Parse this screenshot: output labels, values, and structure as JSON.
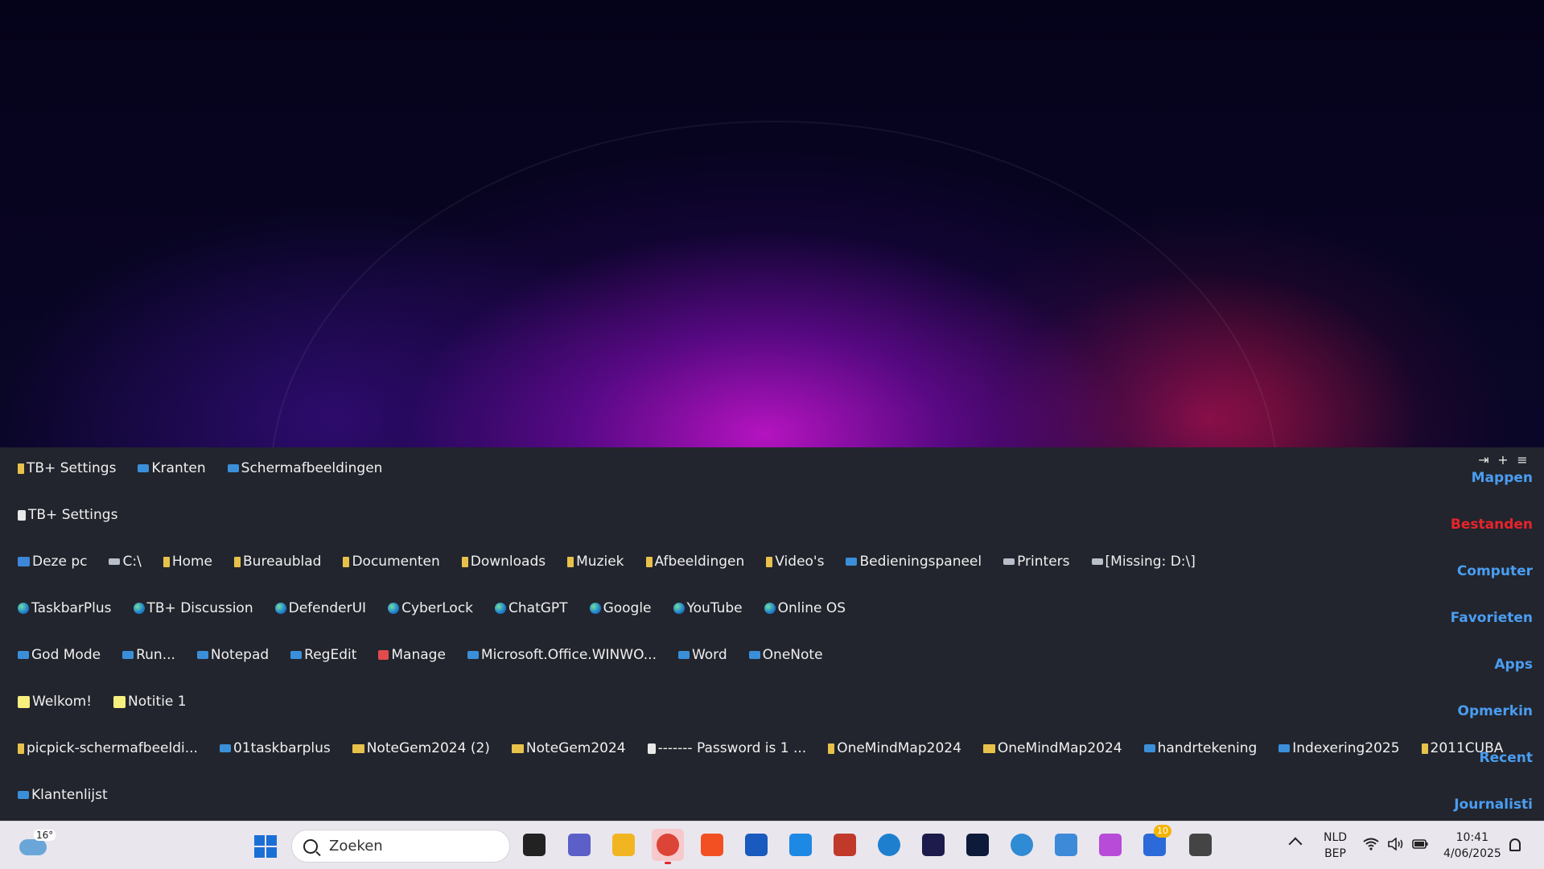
{
  "panel": {
    "controls": [
      "⇥",
      "+",
      "≡"
    ],
    "rows": [
      [
        {
          "icon": "folder",
          "label": "TB+ Settings"
        },
        {
          "icon": "app",
          "label": "Kranten"
        },
        {
          "icon": "app",
          "label": "Schermafbeeldingen"
        }
      ],
      [
        {
          "icon": "doc",
          "label": "TB+ Settings"
        }
      ],
      [
        {
          "icon": "pc",
          "label": "Deze pc"
        },
        {
          "icon": "grey",
          "label": "C:\\"
        },
        {
          "icon": "folder",
          "label": "Home"
        },
        {
          "icon": "folder",
          "label": "Bureaublad"
        },
        {
          "icon": "folder",
          "label": "Documenten"
        },
        {
          "icon": "folder",
          "label": "Downloads"
        },
        {
          "icon": "folder",
          "label": "Muziek"
        },
        {
          "icon": "folder",
          "label": "Afbeeldingen"
        },
        {
          "icon": "folder",
          "label": "Video's"
        },
        {
          "icon": "app",
          "label": "Bedieningspaneel"
        },
        {
          "icon": "grey",
          "label": "Printers"
        },
        {
          "icon": "grey",
          "label": "[Missing: D:\\]"
        }
      ],
      [
        {
          "icon": "edge",
          "label": "TaskbarPlus"
        },
        {
          "icon": "edge",
          "label": "TB+ Discussion"
        },
        {
          "icon": "edge",
          "label": "DefenderUI"
        },
        {
          "icon": "edge",
          "label": "CyberLock"
        },
        {
          "icon": "edge",
          "label": "ChatGPT"
        },
        {
          "icon": "edge",
          "label": "Google"
        },
        {
          "icon": "edge",
          "label": "YouTube"
        },
        {
          "icon": "edge",
          "label": "Online OS"
        }
      ],
      [
        {
          "icon": "app",
          "label": "God Mode"
        },
        {
          "icon": "app",
          "label": "Run..."
        },
        {
          "icon": "app",
          "label": "Notepad"
        },
        {
          "icon": "app",
          "label": "RegEdit"
        },
        {
          "icon": "red",
          "label": "Manage"
        },
        {
          "icon": "app",
          "label": "Microsoft.Office.WINWO..."
        },
        {
          "icon": "app",
          "label": "Word"
        },
        {
          "icon": "app",
          "label": "OneNote"
        }
      ],
      [
        {
          "icon": "note",
          "label": "Welkom!"
        },
        {
          "icon": "note",
          "label": "Notitie 1"
        }
      ],
      [
        {
          "icon": "folder",
          "label": "picpick-schermafbeeldi..."
        },
        {
          "icon": "app",
          "label": "01taskbarplus"
        },
        {
          "icon": "folder-open",
          "label": "NoteGem2024 (2)"
        },
        {
          "icon": "folder-open",
          "label": "NoteGem2024"
        },
        {
          "icon": "doc",
          "label": "------- Password is 1 ..."
        },
        {
          "icon": "folder",
          "label": "OneMindMap2024"
        },
        {
          "icon": "folder-open",
          "label": "OneMindMap2024"
        },
        {
          "icon": "app",
          "label": "handrtekening"
        },
        {
          "icon": "app",
          "label": "Indexering2025"
        },
        {
          "icon": "folder",
          "label": "2011CUBA"
        }
      ],
      [
        {
          "icon": "app",
          "label": "Klantenlijst"
        }
      ]
    ],
    "side_labels": [
      {
        "label": "Mappen",
        "active": false
      },
      {
        "label": "Bestanden",
        "active": true
      },
      {
        "label": "Computer",
        "active": false
      },
      {
        "label": "Favorieten",
        "active": false
      },
      {
        "label": "Apps",
        "active": false
      },
      {
        "label": "Opmerkin",
        "active": false
      },
      {
        "label": "Recent",
        "active": false
      },
      {
        "label": "Journalisti",
        "active": false
      }
    ],
    "colors": {
      "accent": "#4a9df2",
      "active": "#e8242b",
      "panel_bg": "#22252d"
    }
  },
  "taskbar": {
    "weather_temp": "16°",
    "search_placeholder": "Zoeken",
    "apps": [
      {
        "name": "task-view-icon",
        "color": "#222222"
      },
      {
        "name": "teams-icon",
        "color": "#5b5fc7"
      },
      {
        "name": "file-explorer-icon",
        "color": "#f2b522"
      },
      {
        "name": "chrome-icon",
        "color": "#db4437",
        "active": true
      },
      {
        "name": "store-icon",
        "color": "#f25022"
      },
      {
        "name": "word-icon",
        "color": "#185abd"
      },
      {
        "name": "myhp-icon",
        "color": "#1e88e5"
      },
      {
        "name": "winaero-icon",
        "color": "#c0392b"
      },
      {
        "name": "edge-icon",
        "color": "#1f7fcf"
      },
      {
        "name": "lens-icon",
        "color": "#1c1b4b"
      },
      {
        "name": "camera-icon",
        "color": "#0e1a3a"
      },
      {
        "name": "globe-icon",
        "color": "#2f8bd3"
      },
      {
        "name": "snipping-icon",
        "color": "#3c8ad8"
      },
      {
        "name": "copilot-icon",
        "color": "#b84bd8"
      },
      {
        "name": "todo-icon",
        "color": "#2b6ad8"
      },
      {
        "name": "taskbarplus-icon",
        "color": "#444444"
      }
    ],
    "todo_badge": "10",
    "language": {
      "line1": "NLD",
      "line2": "BEP"
    },
    "time": "10:41",
    "date": "4/06/2025"
  }
}
